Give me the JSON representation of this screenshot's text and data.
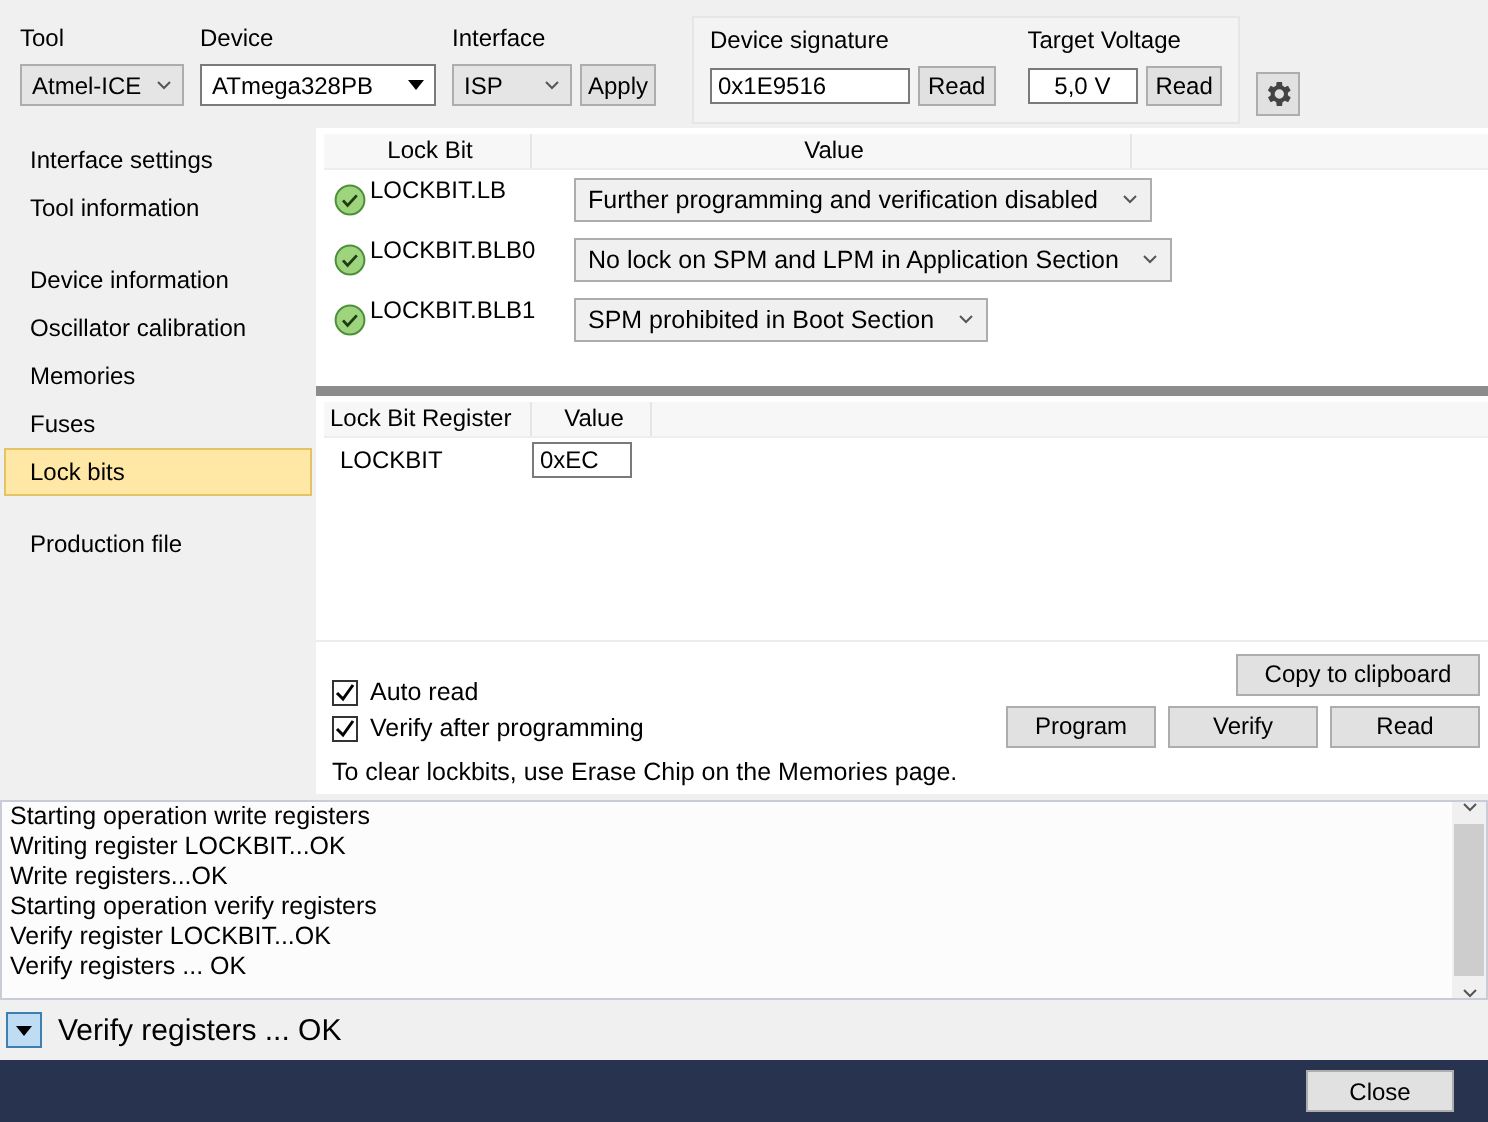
{
  "toolbar": {
    "tool": {
      "label": "Tool",
      "value": "Atmel-ICE"
    },
    "device": {
      "label": "Device",
      "value": "ATmega328PB"
    },
    "interface": {
      "label": "Interface",
      "value": "ISP"
    },
    "apply": "Apply",
    "signature": {
      "label": "Device signature",
      "value": "0x1E9516",
      "button": "Read"
    },
    "voltage": {
      "label": "Target Voltage",
      "value": "5,0 V",
      "button": "Read"
    }
  },
  "sidebar": {
    "groups": [
      [
        {
          "label": "Interface settings",
          "selected": false
        },
        {
          "label": "Tool information",
          "selected": false
        }
      ],
      [
        {
          "label": "Device information",
          "selected": false
        },
        {
          "label": "Oscillator calibration",
          "selected": false
        },
        {
          "label": "Memories",
          "selected": false
        },
        {
          "label": "Fuses",
          "selected": false
        },
        {
          "label": "Lock bits",
          "selected": true
        }
      ],
      [
        {
          "label": "Production file",
          "selected": false
        }
      ]
    ]
  },
  "lockbits": {
    "columns": [
      "Lock Bit",
      "Value"
    ],
    "rows": [
      {
        "name": "LOCKBIT.LB",
        "value": "Further programming and verification disabled",
        "ok": true
      },
      {
        "name": "LOCKBIT.BLB0",
        "value": "No lock on SPM and LPM in Application Section",
        "ok": true
      },
      {
        "name": "LOCKBIT.BLB1",
        "value": "SPM prohibited in Boot Section",
        "ok": true
      }
    ]
  },
  "registers": {
    "columns": [
      "Lock Bit Register",
      "Value"
    ],
    "rows": [
      {
        "name": "LOCKBIT",
        "value": "0xEC"
      }
    ]
  },
  "options": [
    {
      "label": "Auto read",
      "checked": true
    },
    {
      "label": "Verify after programming",
      "checked": true
    }
  ],
  "note": "To clear lockbits, use Erase Chip on the Memories page.",
  "copy_button": "Copy to clipboard",
  "actions": [
    "Program",
    "Verify",
    "Read"
  ],
  "log": [
    "Starting operation write registers",
    "Writing register LOCKBIT...OK",
    "Write registers...OK",
    "Starting operation verify registers",
    "Verify register LOCKBIT...OK",
    "Verify registers ... OK"
  ],
  "status": "Verify registers ... OK",
  "close": "Close"
}
